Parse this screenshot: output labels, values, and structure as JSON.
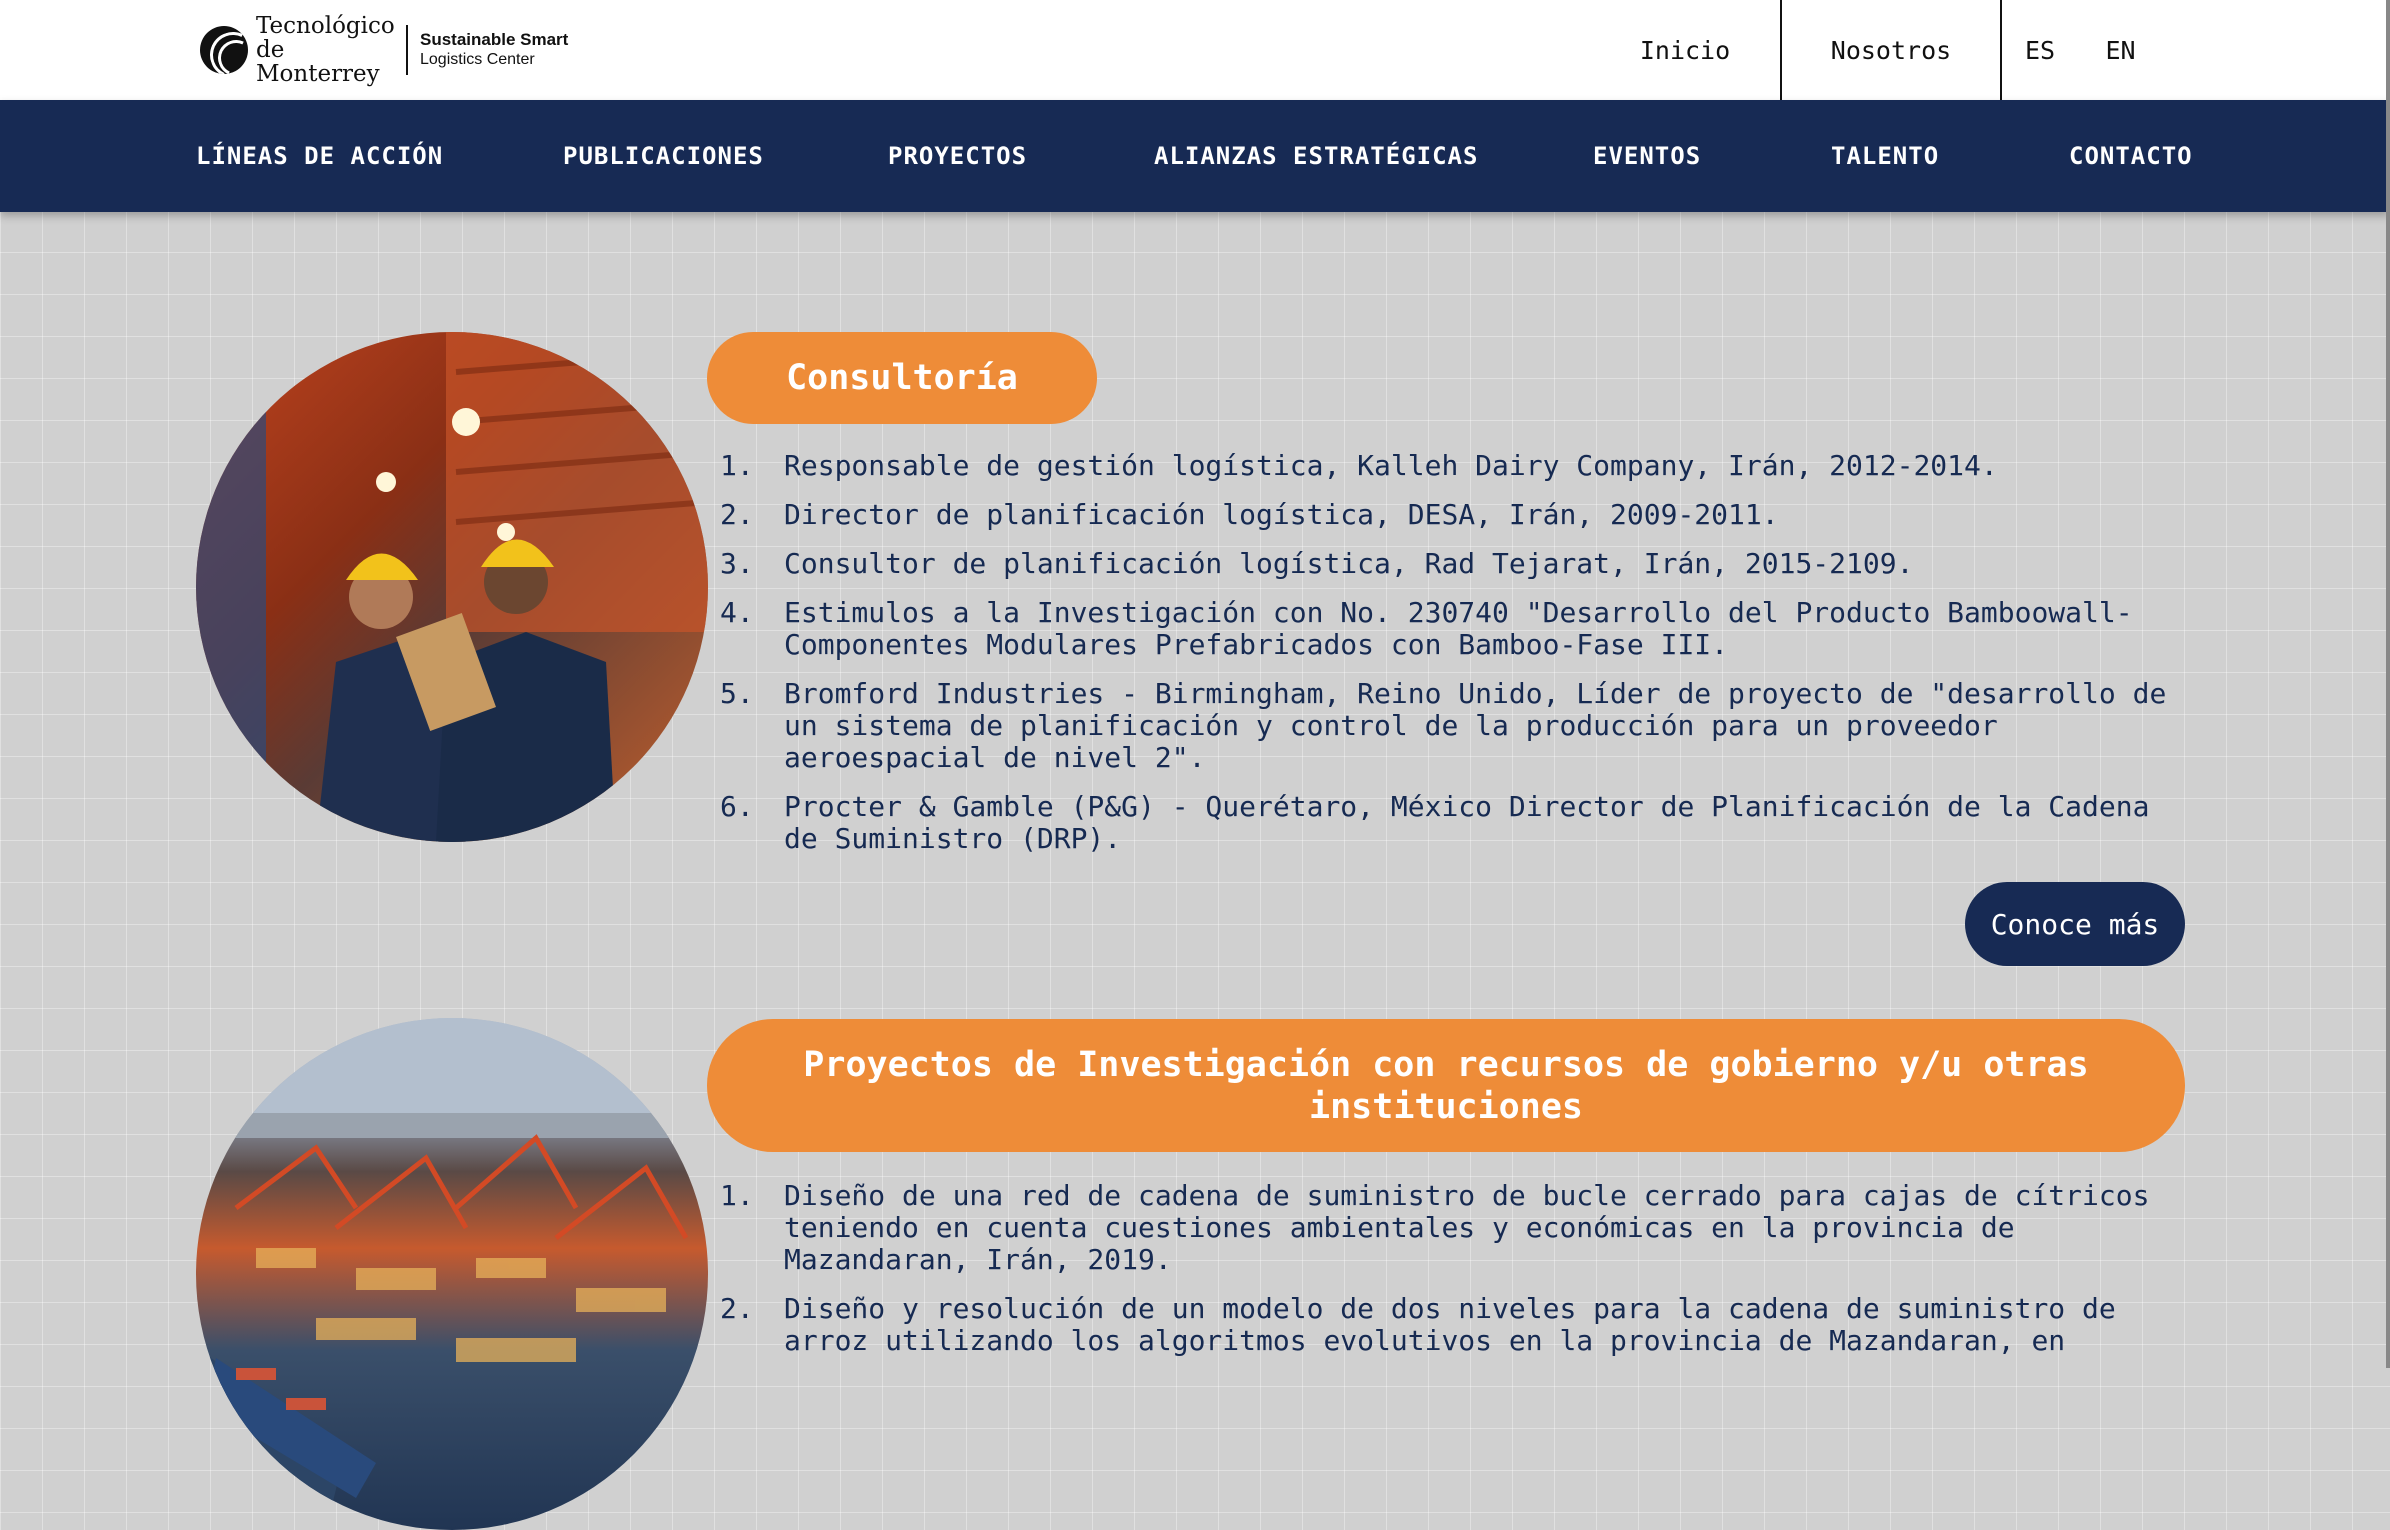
{
  "header": {
    "logo_tec": "Tecnológico de Monterrey",
    "logo_center_line1": "Sustainable Smart",
    "logo_center_line2": "Logistics Center",
    "top_nav": [
      "Inicio",
      "Nosotros"
    ],
    "languages": [
      "ES",
      "EN"
    ]
  },
  "main_nav": [
    "LÍNEAS DE ACCIÓN",
    "PUBLICACIONES",
    "PROYECTOS",
    "ALIANZAS ESTRATÉGICAS",
    "EVENTOS",
    "TALENTO",
    "CONTACTO"
  ],
  "sections": [
    {
      "title": "Consultoría",
      "image": "warehouse-workers-photo",
      "items": [
        "Responsable de gestión logística, Kalleh Dairy Company, Irán, 2012-2014.",
        "Director de planificación logística, DESA, Irán, 2009-2011.",
        "Consultor de planificación logística, Rad Tejarat, Irán, 2015-2109.",
        "Estimulos a la Investigación con No. 230740 \"Desarrollo del Producto Bamboowall-Componentes Modulares Prefabricados con Bamboo-Fase III.",
        "Bromford Industries - Birmingham, Reino Unido, Líder de proyecto de \"desarrollo de un sistema de planificación y control de la producción para un proveedor aeroespacial de nivel 2\".",
        "Procter & Gamble (P&G) - Querétaro, México Director de Planificación de la Cadena de Suministro (DRP)."
      ],
      "button": "Conoce más"
    },
    {
      "title": "Proyectos de Investigación con recursos de gobierno y/u otras instituciones",
      "image": "container-port-photo",
      "items": [
        "Diseño de una red de cadena de suministro de bucle cerrado para cajas de cítricos teniendo en cuenta cuestiones ambientales y económicas en la provincia de Mazandaran, Irán, 2019.",
        "Diseño y resolución de un modelo de dos niveles para la cadena de suministro de arroz utilizando los algoritmos evolutivos en la provincia de Mazandaran, en"
      ]
    }
  ],
  "colors": {
    "navy": "#172a54",
    "orange": "#ee8c38",
    "background": "#d0d0d0"
  }
}
